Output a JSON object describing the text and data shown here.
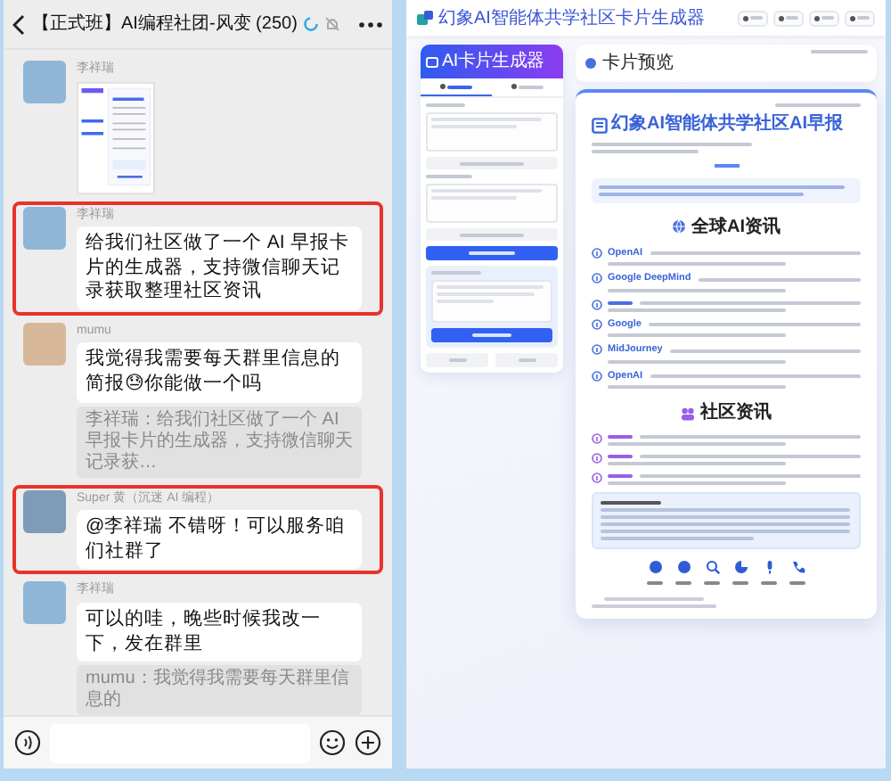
{
  "chat": {
    "title": "【正式班】AI编程社团-风变 (250)",
    "messages": [
      {
        "sender": "李祥瑞",
        "kind": "image",
        "highlighted": false
      },
      {
        "sender": "李祥瑞",
        "kind": "text",
        "text": "给我们社区做了一个 AI 早报卡片的生成器，支持微信聊天记录获取整理社区资讯",
        "highlighted": true
      },
      {
        "sender": "mumu",
        "kind": "text",
        "text": "我觉得我需要每天群里信息的简报😓你能做一个吗",
        "quote": "李祥瑞：给我们社区做了一个 AI 早报卡片的生成器，支持微信聊天记录获…",
        "highlighted": false
      },
      {
        "sender": "Super 黄（沉迷 AI 编程）",
        "kind": "text",
        "text": "@李祥瑞 不错呀！可以服务咱们社群了",
        "highlighted": true
      },
      {
        "sender": "李祥瑞",
        "kind": "text",
        "text": "可以的哇，晚些时候我改一下，发在群里",
        "quote": "mumu：我觉得我需要每天群里信息的",
        "highlighted": false
      }
    ]
  },
  "generator": {
    "app_title": "幻象AI智能体共学社区卡片生成器",
    "panel_title": "AI卡片生成器",
    "tabs": [
      {
        "selected": true
      },
      {
        "selected": false
      }
    ],
    "preview_title": "卡片预览",
    "card": {
      "title": "幻象AI智能体共学社区AI早报",
      "sections": [
        {
          "title": "全球AI资讯",
          "kind": "global",
          "items": [
            {
              "kind": "news",
              "lead": "OpenAI"
            },
            {
              "kind": "news",
              "lead": "Google DeepMind"
            },
            {
              "kind": "news"
            },
            {
              "kind": "news",
              "lead": "Google"
            },
            {
              "kind": "news",
              "lead": "MidJourney"
            },
            {
              "kind": "news",
              "lead": "OpenAI"
            }
          ]
        },
        {
          "title": "社区资讯",
          "kind": "community",
          "items": [
            {
              "kind": "news"
            },
            {
              "kind": "news"
            },
            {
              "kind": "news"
            }
          ]
        }
      ]
    }
  }
}
